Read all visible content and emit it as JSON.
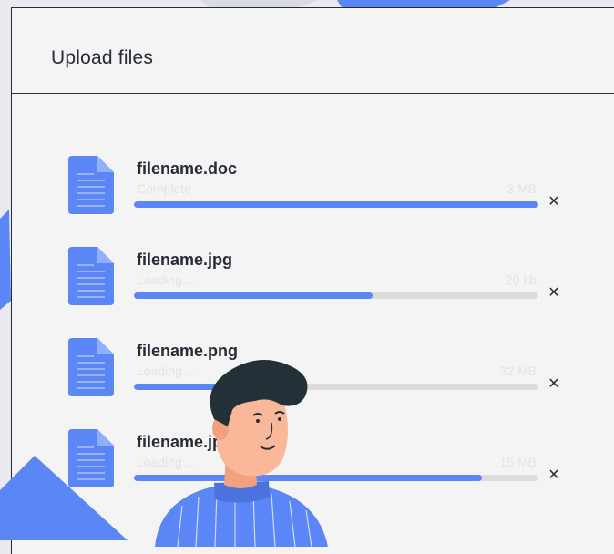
{
  "panel": {
    "title": "Upload files"
  },
  "files": [
    {
      "name": "filename.doc",
      "status": "Complete",
      "size": "3 MB",
      "progress": 1.0
    },
    {
      "name": "filename.jpg",
      "status": "Loading ...",
      "size": "20 kb",
      "progress": 0.59
    },
    {
      "name": "filename.png",
      "status": "Loading ...",
      "size": "32 MB",
      "progress": 0.3
    },
    {
      "name": "filename.jpg",
      "status": "Loading ...",
      "size": "15 MB",
      "progress": 0.86
    }
  ],
  "icons": {
    "file": "document-icon",
    "remove": "close-icon"
  },
  "colors": {
    "accent": "#5b86f5",
    "text": "#262c35",
    "track": "#dcdcdc",
    "panel": "#f4f4f4"
  }
}
